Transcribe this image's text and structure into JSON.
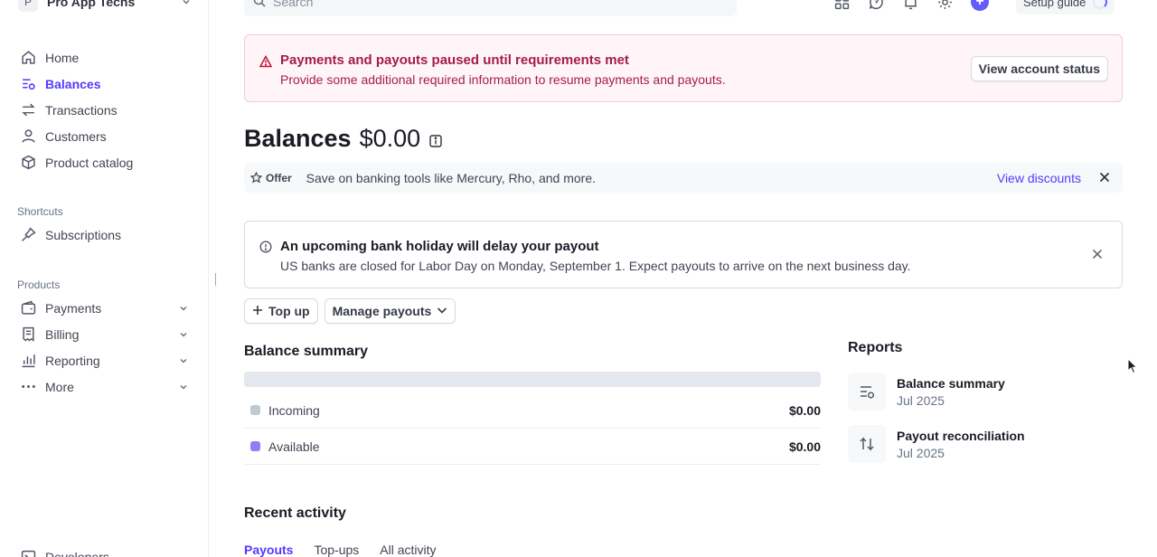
{
  "account": {
    "initial": "P",
    "name": "Pro App Techs"
  },
  "sidebar": {
    "main": [
      {
        "label": "Home",
        "icon": "home-icon"
      },
      {
        "label": "Balances",
        "icon": "balances-icon",
        "active": true
      },
      {
        "label": "Transactions",
        "icon": "transactions-icon"
      },
      {
        "label": "Customers",
        "icon": "customers-icon"
      },
      {
        "label": "Product catalog",
        "icon": "product-catalog-icon"
      }
    ],
    "shortcuts_title": "Shortcuts",
    "shortcuts": [
      {
        "label": "Subscriptions",
        "icon": "pin-icon"
      }
    ],
    "products_title": "Products",
    "products": [
      {
        "label": "Payments",
        "icon": "payments-icon"
      },
      {
        "label": "Billing",
        "icon": "billing-icon"
      },
      {
        "label": "Reporting",
        "icon": "reporting-icon"
      },
      {
        "label": "More",
        "icon": "more-icon"
      }
    ],
    "bottom": {
      "label": "Developers",
      "icon": "developers-icon"
    }
  },
  "topbar": {
    "search_placeholder": "Search",
    "setup_guide": "Setup guide",
    "accent": "#635bff"
  },
  "alert": {
    "title": "Payments and payouts paused until requirements met",
    "description": "Provide some additional required information to resume payments and payouts.",
    "button": "View account status",
    "color": "#a41c4e"
  },
  "page": {
    "title": "Balances",
    "amount": "$0.00"
  },
  "offer": {
    "badge": "Offer",
    "text": "Save on banking tools like Mercury, Rho, and more.",
    "link": "View discounts"
  },
  "notice": {
    "title": "An upcoming bank holiday will delay your payout",
    "description": "US banks are closed for Labor Day on Monday, September 1. Expect payouts to arrive on the next business day."
  },
  "actions": {
    "top_up": "Top up",
    "manage_payouts": "Manage payouts"
  },
  "balance_summary": {
    "title": "Balance summary",
    "fill_fraction": 0,
    "rows": [
      {
        "label": "Incoming",
        "value": "$0.00",
        "color": "#c1c9d2"
      },
      {
        "label": "Available",
        "value": "$0.00",
        "color": "#8d7ffa"
      }
    ]
  },
  "reports": {
    "title": "Reports",
    "items": [
      {
        "name": "Balance summary",
        "date": "Jul 2025",
        "icon": "report-list-icon"
      },
      {
        "name": "Payout reconciliation",
        "date": "Jul 2025",
        "icon": "arrows-updown-icon"
      }
    ]
  },
  "recent_activity": {
    "title": "Recent activity",
    "tabs": [
      {
        "label": "Payouts",
        "active": true
      },
      {
        "label": "Top-ups"
      },
      {
        "label": "All activity"
      }
    ]
  }
}
